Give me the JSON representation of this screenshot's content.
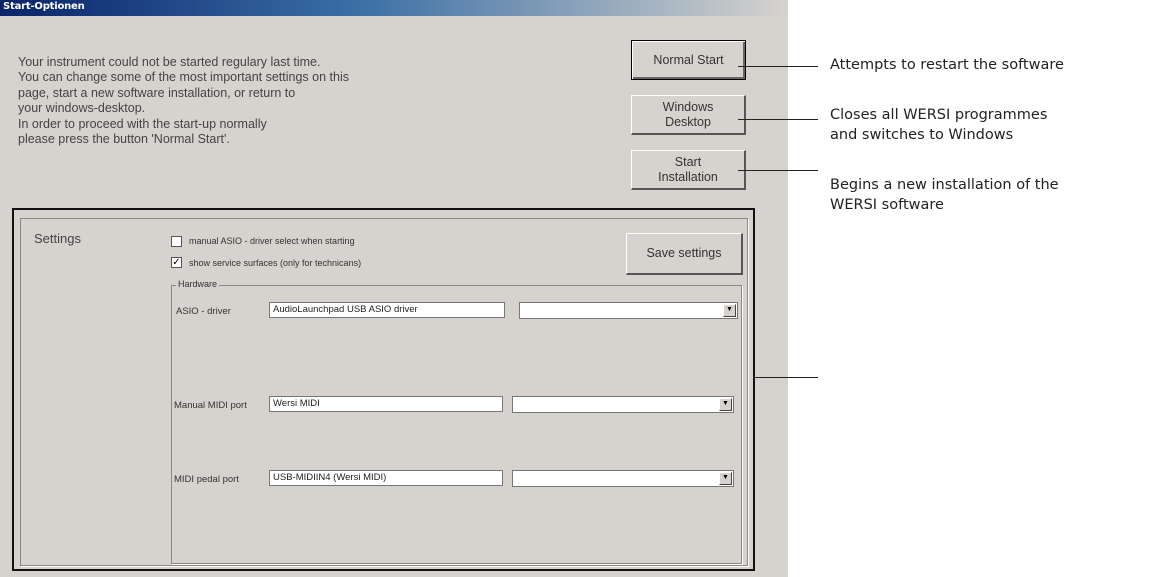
{
  "window": {
    "title": "Start-Optionen"
  },
  "intro": {
    "lines": [
      "Your instrument could not be started regulary last time.",
      "You can change some of the most important settings on this",
      "page, start a new software installation, or return to",
      "your windows-desktop.",
      "In order to proceed with the start-up normally",
      "please press the button 'Normal Start'."
    ]
  },
  "buttons": {
    "normal_start": "Normal Start",
    "windows_desktop": [
      "Windows",
      "Desktop"
    ],
    "start_installation": [
      "Start",
      "Installation"
    ],
    "save_settings": "Save settings"
  },
  "settings": {
    "label": "Settings",
    "checkbox_asio": {
      "label": "manual ASIO - driver select when starting",
      "checked": false
    },
    "checkbox_service": {
      "label": "show service surfaces (only for technicans)",
      "checked": true
    },
    "hardware": {
      "title": "Hardware",
      "asio": {
        "label": "ASIO - driver",
        "value": "AudioLaunchpad USB ASIO driver",
        "select_value": ""
      },
      "manual_midi": {
        "label": "Manual MIDI port",
        "value": "Wersi MIDI",
        "select_value": ""
      },
      "pedal_midi": {
        "label": "MIDI pedal port",
        "value": "USB-MIDIIN4 (Wersi MIDI)",
        "select_value": ""
      }
    }
  },
  "annotations": {
    "normal_start": [
      "Attempts to restart the software"
    ],
    "windows_desktop": [
      "Closes all WERSI programmes",
      "and switches to Windows"
    ],
    "start_installation": [
      "Begins a new installation of the",
      "WERSI software"
    ]
  },
  "icons": {
    "combo_arrow": "chevron-down-icon",
    "checkmark": "check-icon"
  }
}
